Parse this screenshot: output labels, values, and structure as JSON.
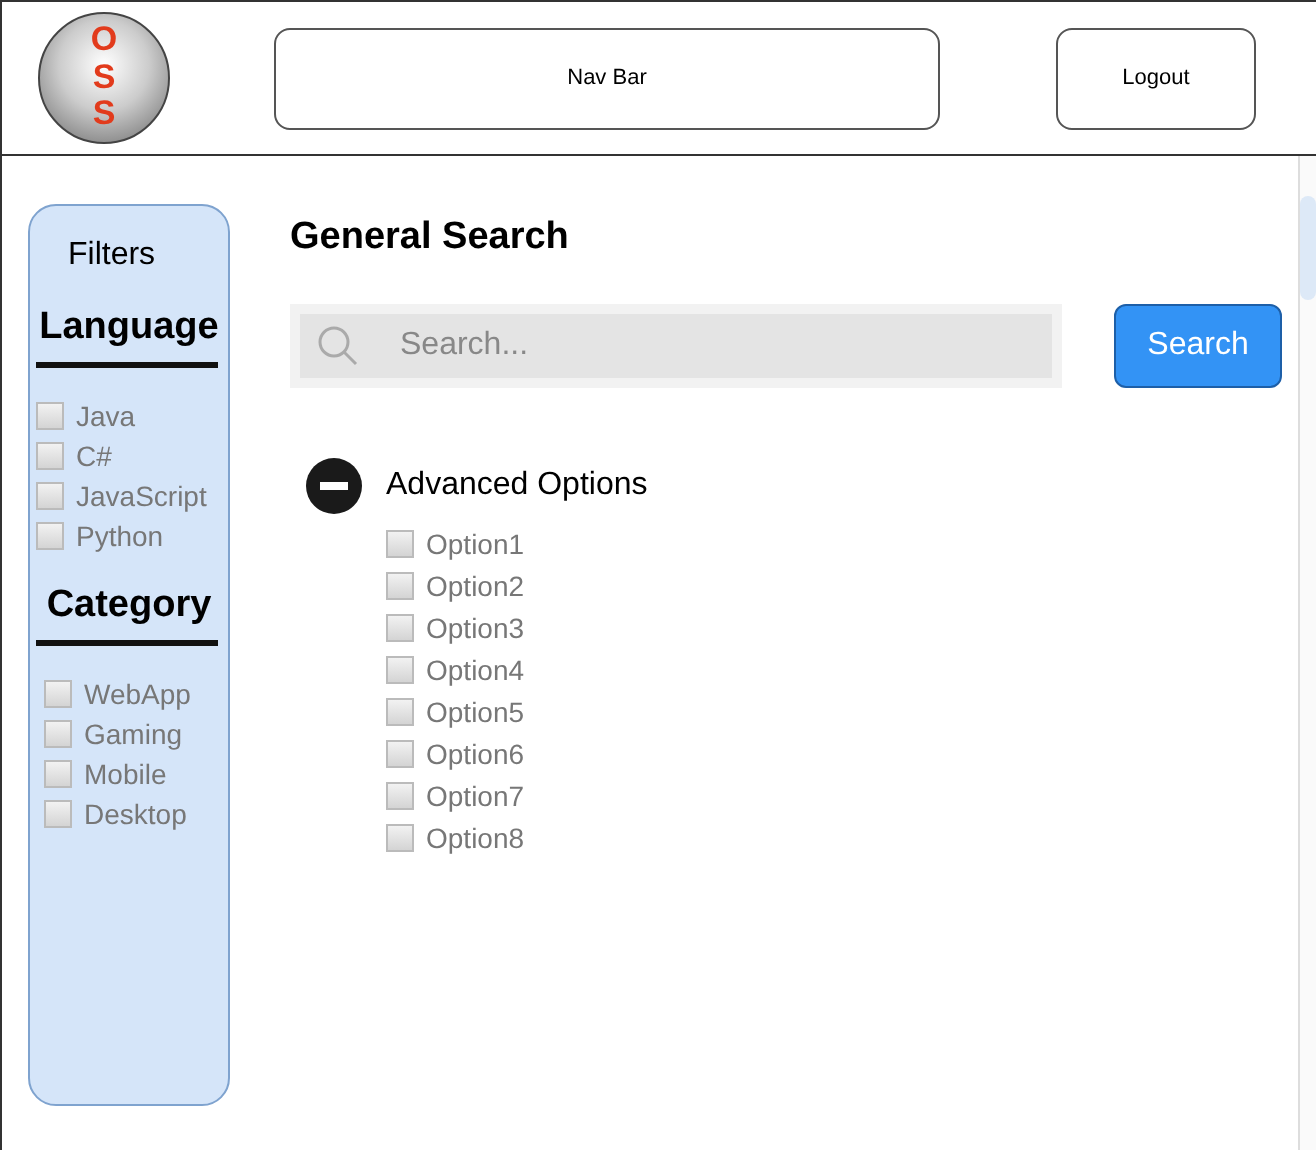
{
  "header": {
    "logo_text": "OSS",
    "nav_bar": "Nav Bar",
    "logout": "Logout"
  },
  "filters": {
    "title": "Filters",
    "groups": [
      {
        "heading": "Language",
        "options": [
          {
            "label": "Java",
            "checked": false
          },
          {
            "label": "C#",
            "checked": false
          },
          {
            "label": "JavaScript",
            "checked": false
          },
          {
            "label": "Python",
            "checked": false
          }
        ]
      },
      {
        "heading": "Category",
        "options": [
          {
            "label": "WebApp",
            "checked": false
          },
          {
            "label": "Gaming",
            "checked": false
          },
          {
            "label": "Mobile",
            "checked": false
          },
          {
            "label": "Desktop",
            "checked": false
          }
        ]
      }
    ]
  },
  "search": {
    "title": "General Search",
    "placeholder": "Search...",
    "button": "Search"
  },
  "advanced": {
    "label": "Advanced Options",
    "expanded": true,
    "options": [
      {
        "label": "Option1",
        "checked": false
      },
      {
        "label": "Option2",
        "checked": false
      },
      {
        "label": "Option3",
        "checked": false
      },
      {
        "label": "Option4",
        "checked": false
      },
      {
        "label": "Option5",
        "checked": false
      },
      {
        "label": "Option6",
        "checked": false
      },
      {
        "label": "Option7",
        "checked": false
      },
      {
        "label": "Option8",
        "checked": false
      }
    ]
  }
}
